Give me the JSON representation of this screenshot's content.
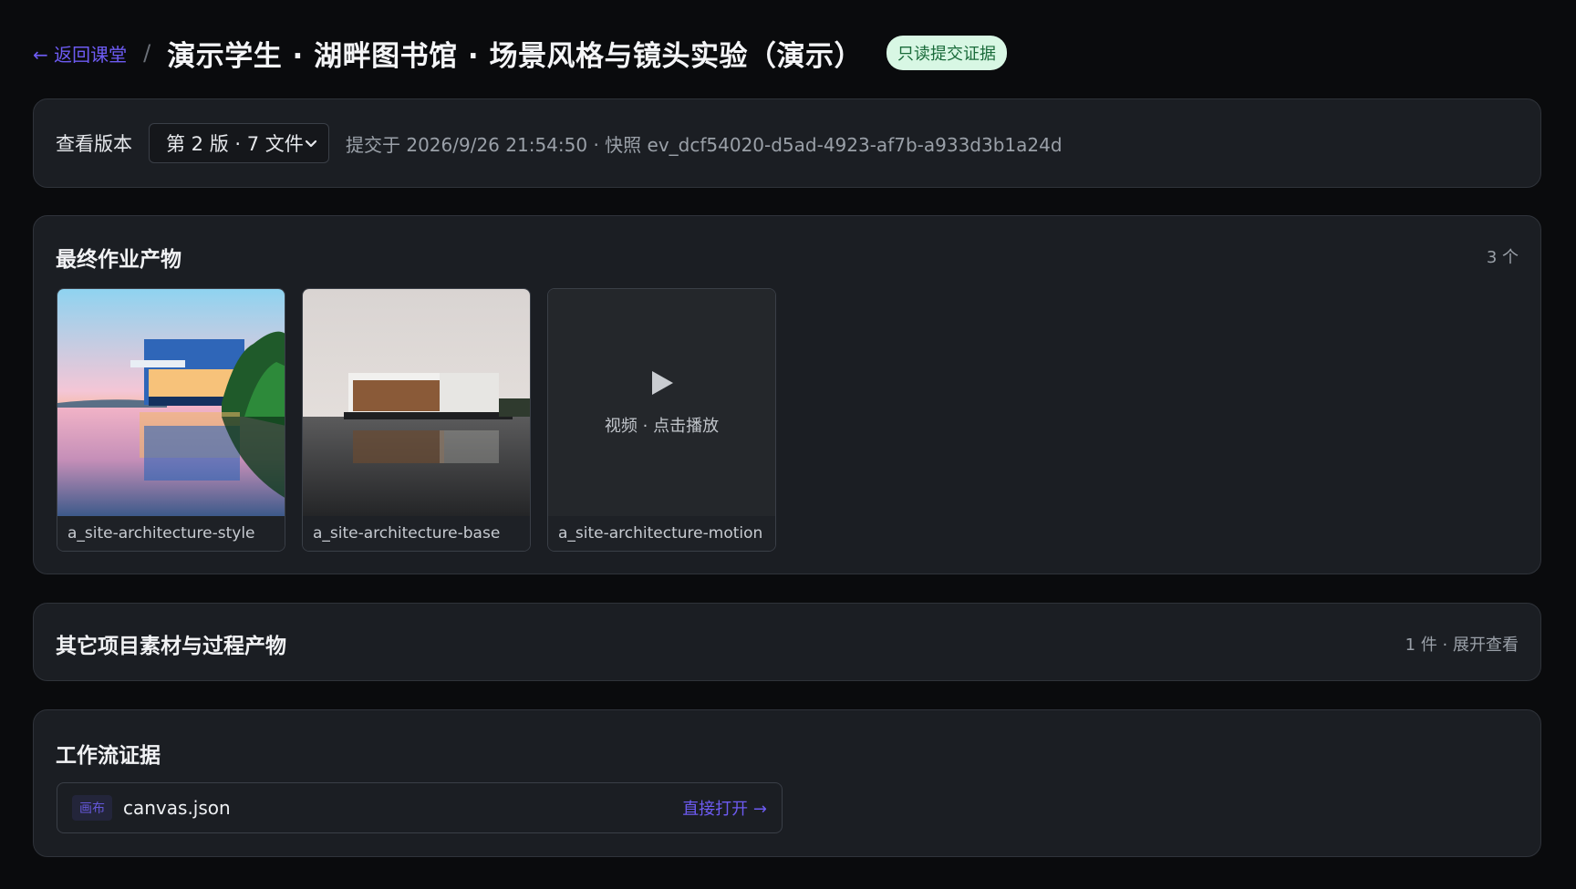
{
  "header": {
    "back_label": "← 返回课堂",
    "separator": "/",
    "title": "演示学生 · 湖畔图书馆 · 场景风格与镜头实验（演示）",
    "badge": "只读提交证据"
  },
  "version": {
    "label": "查看版本",
    "selected": "第 2 版 · 7 文件",
    "meta": "提交于 2026/9/26 21:54:50 · 快照 ev_dcf54020-d5ad-4923-af7b-a933d3b1a24d"
  },
  "final_outputs": {
    "title": "最终作业产物",
    "count": "3 个",
    "items": [
      {
        "caption": "a_site-architecture-style",
        "kind": "image"
      },
      {
        "caption": "a_site-architecture-base",
        "kind": "image"
      },
      {
        "caption": "a_site-architecture-motion",
        "kind": "video",
        "overlay": "视频 · 点击播放"
      }
    ]
  },
  "other_assets": {
    "title": "其它项目素材与过程产物",
    "summary": "1 件 · 展开查看"
  },
  "workflow": {
    "title": "工作流证据",
    "items": [
      {
        "tag": "画布",
        "file": "canvas.json",
        "action": "直接打开 →"
      }
    ]
  },
  "colors": {
    "accent": "#6d5bf2",
    "badge_bg": "#d8f7e4",
    "panel_bg": "#1b1e23",
    "page_bg": "#0a0b0d"
  },
  "icons": {
    "select": "chevron-down-icon",
    "video": "play-icon"
  }
}
